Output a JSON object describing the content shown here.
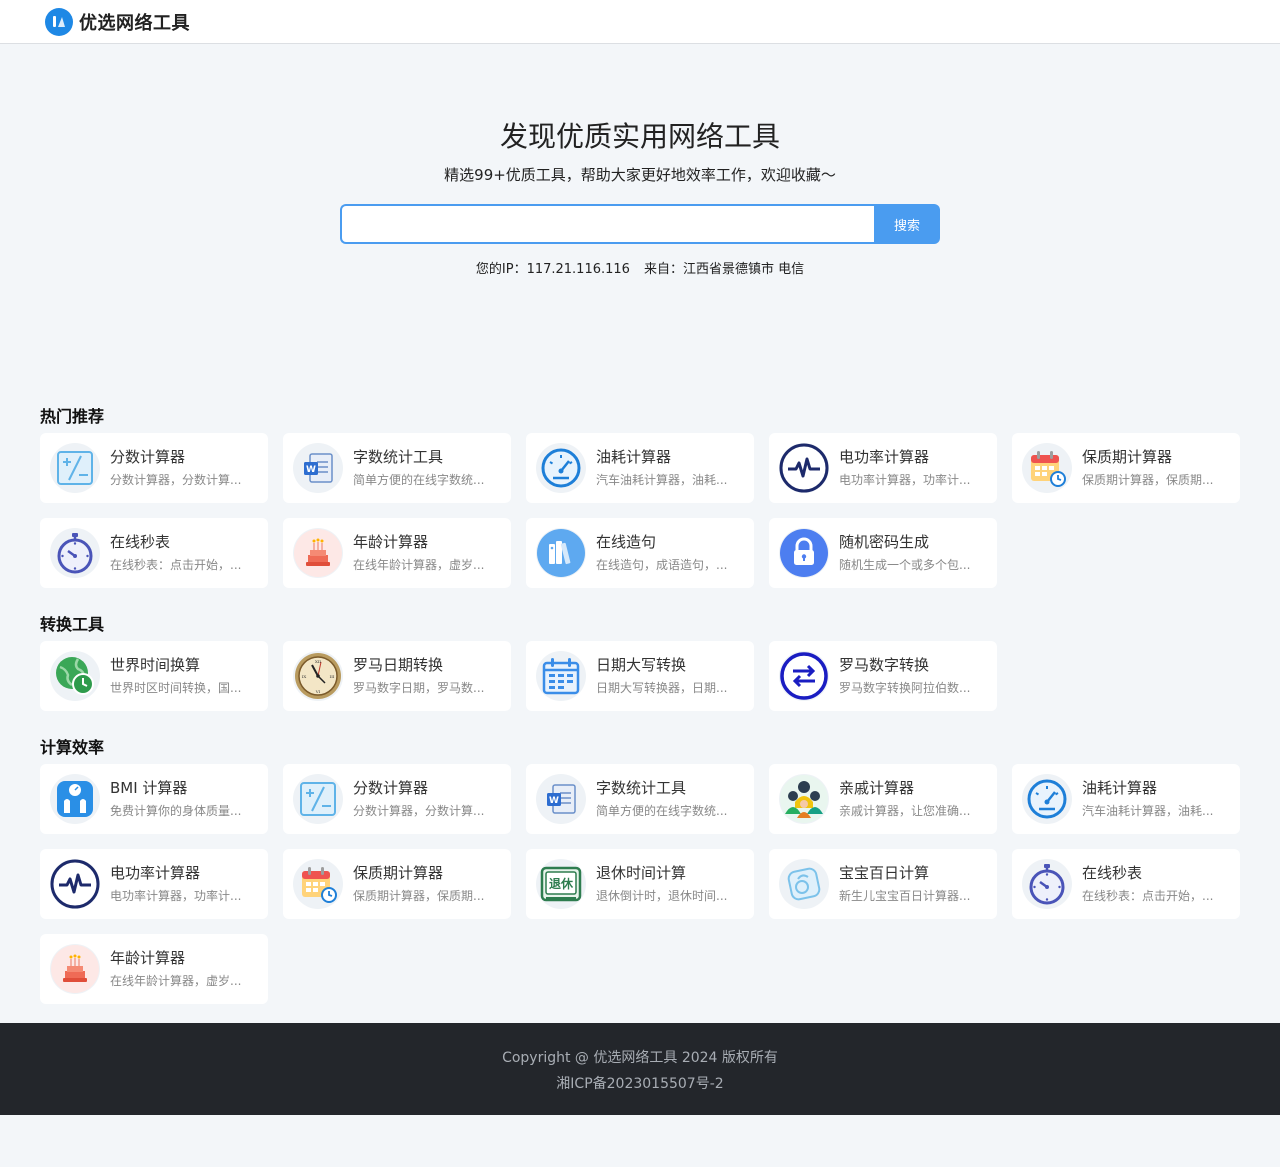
{
  "site": {
    "name": "优选网络工具"
  },
  "hero": {
    "title": "发现优质实用网络工具",
    "subtitle": "精选99+优质工具，帮助大家更好地效率工作，欢迎收藏～",
    "search_placeholder": "",
    "search_button": "搜索",
    "ip_label": "您的IP：117.21.116.116",
    "from_label": "来自：江西省景德镇市 电信"
  },
  "sections": [
    {
      "title": "热门推荐",
      "items": [
        {
          "title": "分数计算器",
          "desc": "分数计算器，分数计算...",
          "icon": "fraction-calculator-icon"
        },
        {
          "title": "字数统计工具",
          "desc": "简单方便的在线字数统...",
          "icon": "word-document-icon"
        },
        {
          "title": "油耗计算器",
          "desc": "汽车油耗计算器，油耗...",
          "icon": "speedometer-icon"
        },
        {
          "title": "电功率计算器",
          "desc": "电功率计算器，功率计...",
          "icon": "pulse-icon"
        },
        {
          "title": "保质期计算器",
          "desc": "保质期计算器，保质期...",
          "icon": "calendar-clock-icon"
        },
        {
          "title": "在线秒表",
          "desc": "在线秒表：点击开始，...",
          "icon": "stopwatch-icon"
        },
        {
          "title": "年龄计算器",
          "desc": "在线年龄计算器，虚岁...",
          "icon": "birthday-cake-icon"
        },
        {
          "title": "在线造句",
          "desc": "在线造句，成语造句，...",
          "icon": "books-icon"
        },
        {
          "title": "随机密码生成",
          "desc": "随机生成一个或多个包...",
          "icon": "lock-icon"
        }
      ]
    },
    {
      "title": "转换工具",
      "items": [
        {
          "title": "世界时间换算",
          "desc": "世界时区时间转换，国...",
          "icon": "globe-clock-icon"
        },
        {
          "title": "罗马日期转换",
          "desc": "罗马数字日期，罗马数...",
          "icon": "roman-clock-icon"
        },
        {
          "title": "日期大写转换",
          "desc": "日期大写转换器，日期...",
          "icon": "calendar-icon"
        },
        {
          "title": "罗马数字转换",
          "desc": "罗马数字转换阿拉伯数...",
          "icon": "swap-arrows-icon"
        }
      ]
    },
    {
      "title": "计算效率",
      "items": [
        {
          "title": "BMI 计算器",
          "desc": "免费计算你的身体质量...",
          "icon": "bmi-scale-icon"
        },
        {
          "title": "分数计算器",
          "desc": "分数计算器，分数计算...",
          "icon": "fraction-calculator-icon"
        },
        {
          "title": "字数统计工具",
          "desc": "简单方便的在线字数统...",
          "icon": "word-document-icon"
        },
        {
          "title": "亲戚计算器",
          "desc": "亲戚计算器，让您准确...",
          "icon": "family-icon"
        },
        {
          "title": "油耗计算器",
          "desc": "汽车油耗计算器，油耗...",
          "icon": "speedometer-icon"
        },
        {
          "title": "电功率计算器",
          "desc": "电功率计算器，功率计...",
          "icon": "pulse-icon"
        },
        {
          "title": "保质期计算器",
          "desc": "保质期计算器，保质期...",
          "icon": "calendar-clock-icon"
        },
        {
          "title": "退休时间计算",
          "desc": "退休倒计时，退休时间...",
          "icon": "retire-badge-icon",
          "badge": "退休"
        },
        {
          "title": "宝宝百日计算",
          "desc": "新生儿宝宝百日计算器...",
          "icon": "baby-icon"
        },
        {
          "title": "在线秒表",
          "desc": "在线秒表：点击开始，...",
          "icon": "stopwatch-icon"
        },
        {
          "title": "年龄计算器",
          "desc": "在线年龄计算器，虚岁...",
          "icon": "birthday-cake-icon"
        }
      ]
    }
  ],
  "footer": {
    "copyright": "Copyright @ 优选网络工具 2024 版权所有",
    "icp": "湘ICP备2023015507号-2"
  }
}
